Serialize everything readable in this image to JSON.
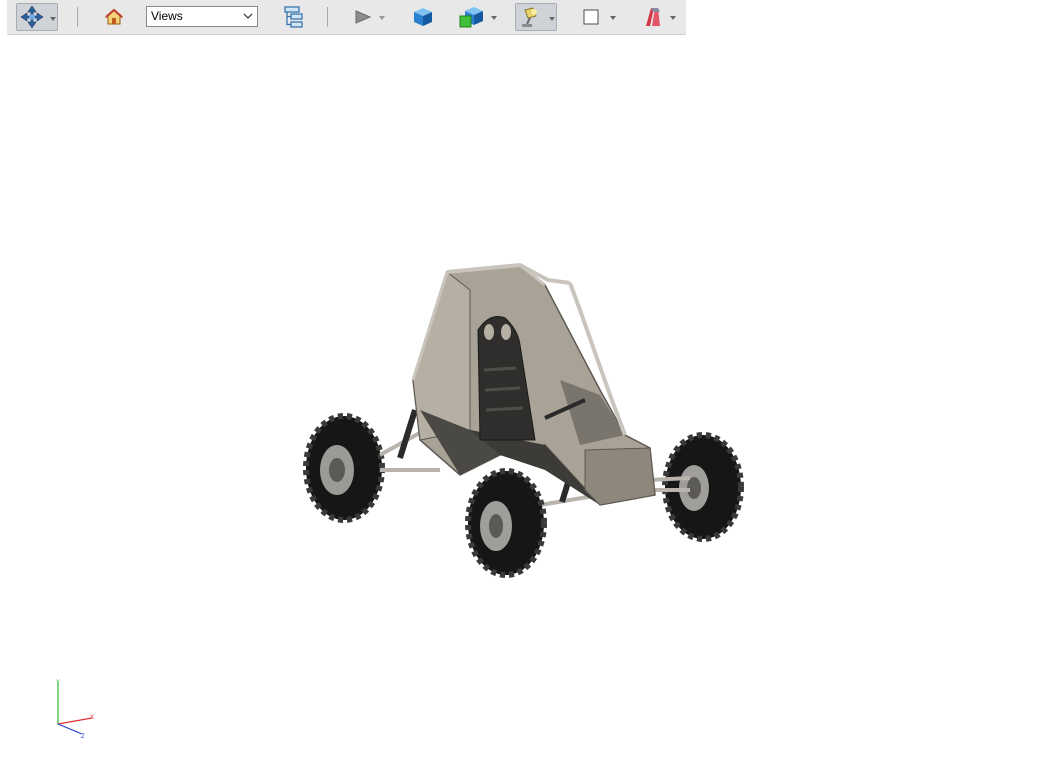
{
  "toolbar": {
    "views_select": {
      "value": "Views"
    },
    "icons": {
      "navigate": "navigate-cross-icon",
      "home": "home-icon",
      "tree": "model-tree-icon",
      "play": "play-icon",
      "shaded": "shaded-cube-icon",
      "display": "display-mode-icon",
      "lighting": "lighting-lamp-icon",
      "background": "background-square-icon",
      "material": "appearance-icon"
    }
  },
  "colors": {
    "toolbar_bg": "#e8e8e8",
    "body_panel": "#a9a296",
    "frame_tube": "#b8b4ad",
    "tire": "#1b1b1b",
    "axis_x": "#e03030",
    "axis_y": "#2fb52f",
    "axis_z": "#2a3fd6"
  },
  "triad": {
    "x_label": "X",
    "y_label": "Y",
    "z_label": "Z"
  }
}
